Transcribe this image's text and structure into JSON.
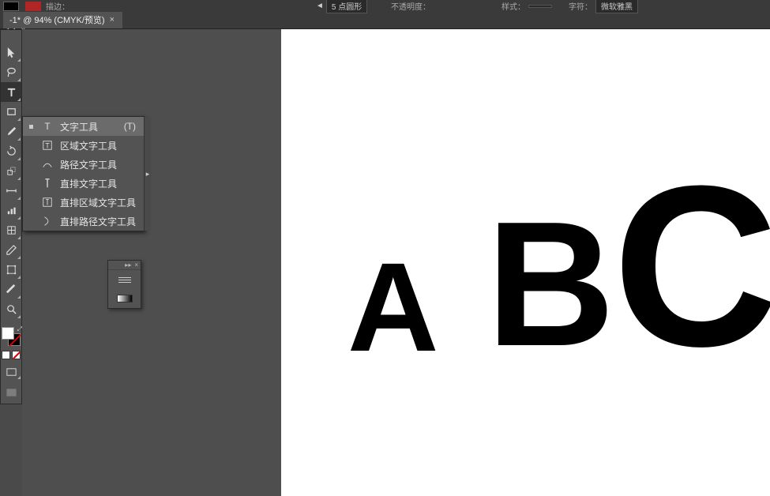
{
  "options_bar": {
    "stroke_label": "描边：",
    "dropdown_text": "5 点圆形",
    "opacity_label": "不透明度："
  },
  "options_right": {
    "style_label": "样式：",
    "font_label": "字符：",
    "font_value": "微软雅黑"
  },
  "tab": {
    "title": "-1* @ 94% (CMYK/预览)"
  },
  "flyout": [
    {
      "label": "文字工具",
      "shortcut": "(T)",
      "selected": true
    },
    {
      "label": "区域文字工具",
      "shortcut": "",
      "selected": false
    },
    {
      "label": "路径文字工具",
      "shortcut": "",
      "selected": false
    },
    {
      "label": "直排文字工具",
      "shortcut": "",
      "selected": false
    },
    {
      "label": "直排区域文字工具",
      "shortcut": "",
      "selected": false
    },
    {
      "label": "直排路径文字工具",
      "shortcut": "",
      "selected": false
    }
  ],
  "canvas": {
    "letters": {
      "a": "A",
      "b": "B",
      "c": "C"
    }
  }
}
